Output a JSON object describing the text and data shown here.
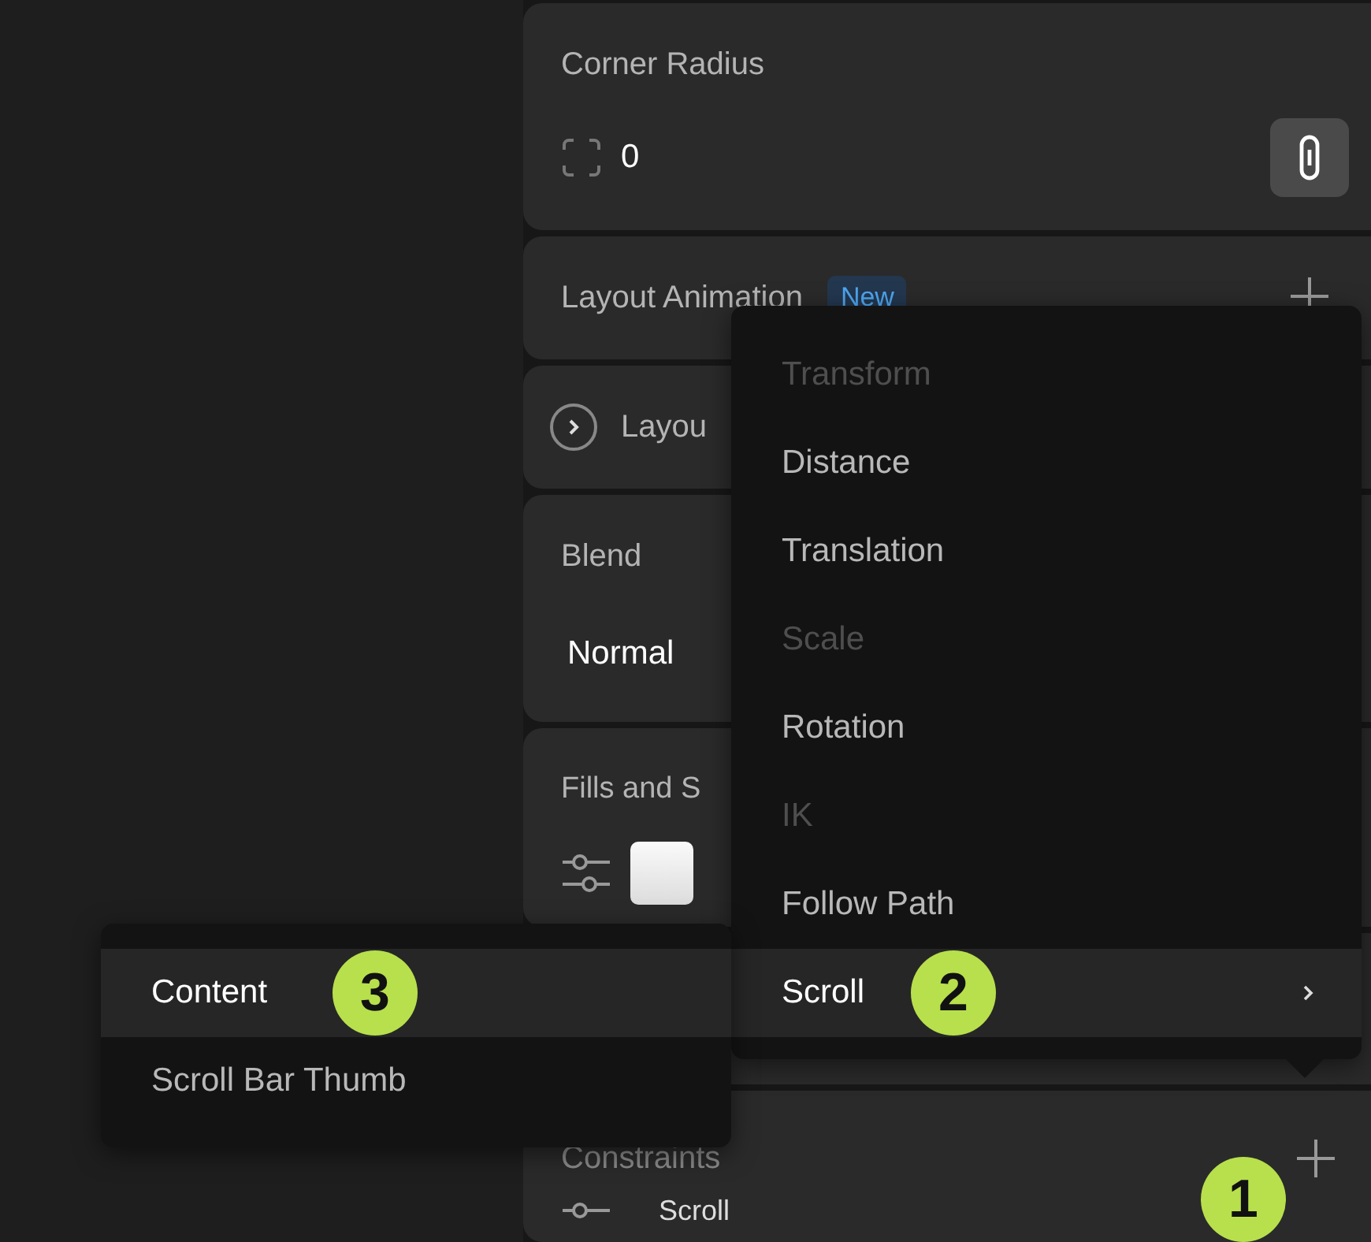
{
  "panel": {
    "corner_radius": {
      "title": "Corner Radius",
      "value": "0"
    },
    "layout_animation": {
      "title": "Layout Animation",
      "badge": "New"
    },
    "layout": {
      "title": "Layou",
      "expanded": false
    },
    "blend": {
      "title": "Blend",
      "value": "Normal"
    },
    "fills": {
      "title": "Fills and S"
    },
    "constraints": {
      "title": "Constraints",
      "rows": [
        {
          "label": "Scroll"
        }
      ]
    }
  },
  "menu": {
    "items": [
      {
        "label": "Transform",
        "disabled": true,
        "selected": false,
        "submenu": false
      },
      {
        "label": "Distance",
        "disabled": false,
        "selected": false,
        "submenu": false
      },
      {
        "label": "Translation",
        "disabled": false,
        "selected": false,
        "submenu": false
      },
      {
        "label": "Scale",
        "disabled": true,
        "selected": false,
        "submenu": false
      },
      {
        "label": "Rotation",
        "disabled": false,
        "selected": false,
        "submenu": false
      },
      {
        "label": "IK",
        "disabled": true,
        "selected": false,
        "submenu": false
      },
      {
        "label": "Follow Path",
        "disabled": false,
        "selected": false,
        "submenu": false
      },
      {
        "label": "Scroll",
        "disabled": false,
        "selected": true,
        "submenu": true
      }
    ]
  },
  "submenu": {
    "items": [
      {
        "label": "Content",
        "selected": true
      },
      {
        "label": "Scroll Bar Thumb",
        "selected": false
      }
    ]
  },
  "callouts": [
    "1",
    "2",
    "3"
  ]
}
